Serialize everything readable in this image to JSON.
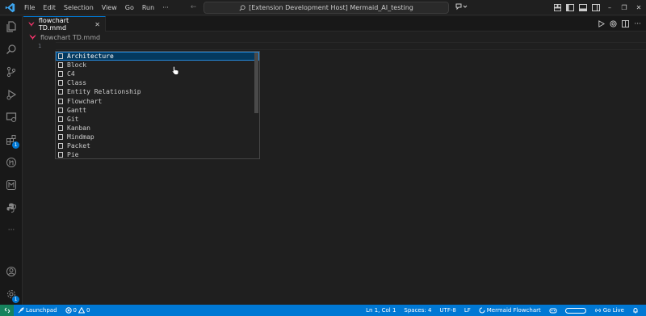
{
  "titlebar": {
    "menu": [
      "File",
      "Edit",
      "Selection",
      "View",
      "Go",
      "Run",
      "···"
    ],
    "command_center": "[Extension Development Host] Mermaid_AI_testing"
  },
  "activity_bar": {
    "icons": [
      "files-icon",
      "search-icon",
      "source-control-icon",
      "run-debug-icon",
      "remote-explorer-icon",
      "extensions-icon",
      "git-graph-icon",
      "mermaid-icon",
      "python-icon",
      "more-icon",
      "accounts-icon",
      "settings-icon"
    ],
    "extensions_badge": "1",
    "settings_badge": "1"
  },
  "tabs": [
    {
      "label": "flowchart TD.mmd",
      "close": "✕"
    }
  ],
  "breadcrumb": {
    "file": "flowchart TD.mmd"
  },
  "editor": {
    "line_number": "1"
  },
  "suggestions": [
    "Architecture",
    "Block",
    "C4",
    "Class",
    "Entity Relationship",
    "Flowchart",
    "Gantt",
    "Git",
    "Kanban",
    "Mindmap",
    "Packet",
    "Pie"
  ],
  "statusbar": {
    "launchpad": "Launchpad",
    "errors": "0",
    "warnings": "0",
    "position": "Ln 1, Col 1",
    "spaces": "Spaces: 4",
    "encoding": "UTF-8",
    "eol": "LF",
    "language": "Mermaid Flowchart",
    "golive": "Go Live"
  },
  "colors": {
    "accent": "#0078d4",
    "selection": "#04395e",
    "mermaid": "#ff3670"
  }
}
